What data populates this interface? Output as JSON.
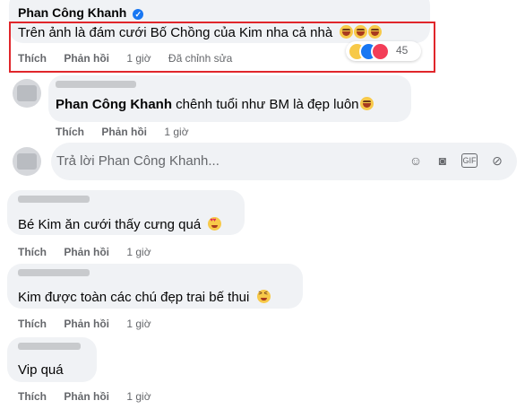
{
  "top_comment": {
    "author": "Phan Công Khanh",
    "text": "Trên ảnh là đám cưới Bố Chồng của Kim nha cả nhà",
    "like": "Thích",
    "reply": "Phản hồi",
    "time": "1 giờ",
    "edited": "Đã chỉnh sửa",
    "reaction_count": "45"
  },
  "reply1": {
    "mention": "Phan Công Khanh",
    "text": "chênh tuổi như BM là đẹp luôn",
    "like": "Thích",
    "reply": "Phản hồi",
    "time": "1 giờ"
  },
  "reply_input": {
    "placeholder": "Trả lời Phan Công Khanh..."
  },
  "comments": [
    {
      "text": "Bé Kim ăn cưới thấy cưng quá",
      "like": "Thích",
      "reply": "Phản hồi",
      "time": "1 giờ"
    },
    {
      "text": "Kim được toàn các chú đẹp trai bế thui",
      "like": "Thích",
      "reply": "Phản hồi",
      "time": "1 giờ"
    },
    {
      "text": "Vip quá",
      "like": "Thích",
      "reply": "Phản hồi",
      "time": "1 giờ"
    }
  ],
  "colors": {
    "highlight": "#e0262b",
    "bubble": "#f0f2f5",
    "meta": "#65676b",
    "verified": "#1877f2"
  },
  "icons": [
    "verified-badge-icon",
    "grinning-emoji",
    "heart-eyes-emoji",
    "squint-emoji",
    "haha-reaction-icon",
    "like-reaction-icon",
    "love-reaction-icon",
    "smiley-icon",
    "camera-icon",
    "gif-icon",
    "sticker-icon"
  ]
}
